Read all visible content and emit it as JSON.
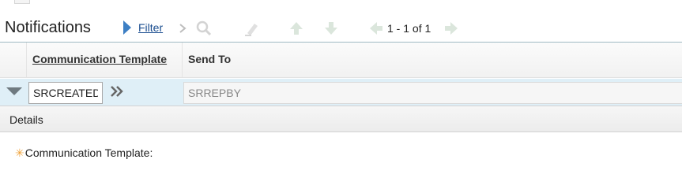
{
  "header": {
    "title": "Notifications",
    "filter_label": "Filter",
    "pager_text": "1 - 1 of 1"
  },
  "table": {
    "columns": [
      "Communication Template",
      "Send To"
    ],
    "row": {
      "communication_template": "SRCREATED",
      "send_to": "SRREPBY"
    }
  },
  "details": {
    "section_label": "Details",
    "field_label": "Communication Template:"
  },
  "icons": {
    "filter": "triangle-right-icon",
    "next_action": "chevron-right-icon",
    "search": "magnifier-icon",
    "clear": "eraser-icon",
    "move_up": "arrow-up-icon",
    "move_down": "arrow-down-icon",
    "prev_page": "arrow-left-icon",
    "next_page": "arrow-right-icon",
    "row_toggle": "triangle-down-icon",
    "related": "double-chevron-icon",
    "required": "asterisk-icon"
  },
  "colors": {
    "link": "#1a4d8f",
    "selected_row": "#dfeff7",
    "required": "#f0a33a",
    "disabled_icon": "#d6d6d6"
  }
}
